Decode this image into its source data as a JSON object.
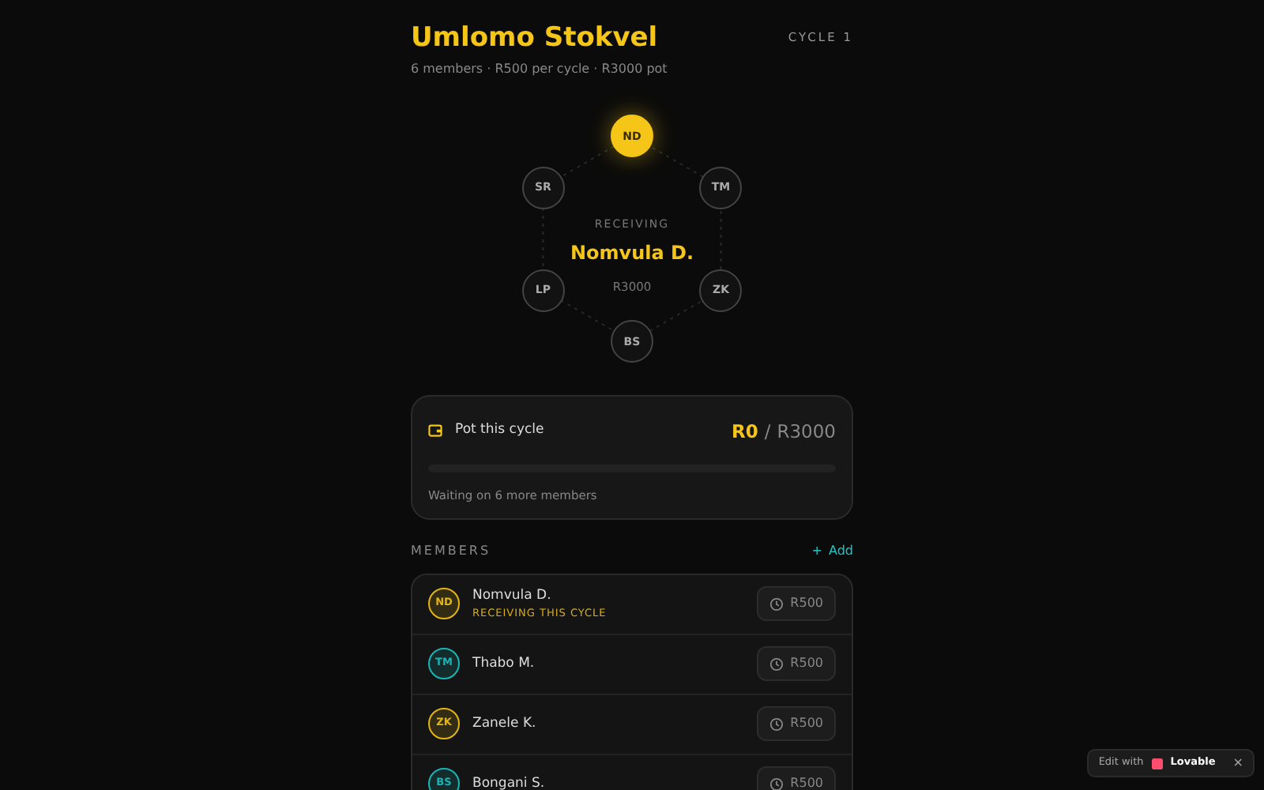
{
  "header": {
    "title": "Umlomo Stokvel",
    "subtitle": "6 members · R500 per cycle · R3000 pot",
    "cycle": "CYCLE 1"
  },
  "ring": {
    "nodes": [
      {
        "initials": "ND",
        "selected": true
      },
      {
        "initials": "TM",
        "selected": false
      },
      {
        "initials": "ZK",
        "selected": false
      },
      {
        "initials": "BS",
        "selected": false
      },
      {
        "initials": "LP",
        "selected": false
      },
      {
        "initials": "SR",
        "selected": false
      }
    ],
    "label": "RECEIVING",
    "name": "Nomvula D.",
    "amount": "R3000"
  },
  "pot": {
    "title": "Pot this cycle",
    "collected": "R0",
    "separator": "/",
    "total": "R3000",
    "level": 0,
    "note": "Waiting on 6 more members"
  },
  "members": {
    "heading": "MEMBERS",
    "add": "Add",
    "add_icon": "+",
    "rows": [
      {
        "initials": "ND",
        "name": "Nomvula D.",
        "tag": "RECEIVING THIS CYCLE",
        "color": "#e3b512",
        "amount": "R500"
      },
      {
        "initials": "TM",
        "name": "Thabo M.",
        "color": "#18b5b5",
        "amount": "R500"
      },
      {
        "initials": "ZK",
        "name": "Zanele K.",
        "color": "#e3b512",
        "amount": "R500"
      },
      {
        "initials": "BS",
        "name": "Bongani S.",
        "color": "#18b5b5",
        "amount": "R500"
      }
    ]
  },
  "badge": {
    "prefix": "Edit with",
    "brand": "Lovable",
    "close": "×"
  }
}
